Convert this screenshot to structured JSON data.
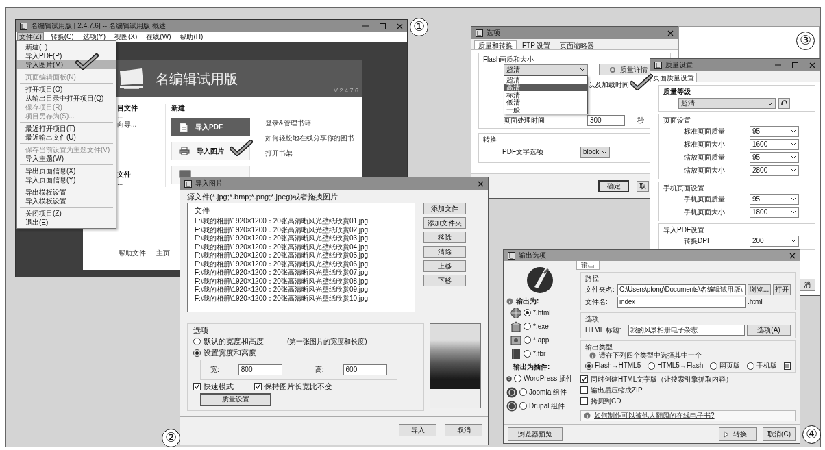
{
  "app_window": {
    "title": "名编辑试用版 [ 2.4.7.6] -- 名编辑试用版 概述",
    "menus": [
      {
        "label": "文件(Z)",
        "selected": true
      },
      {
        "label": "转换(C)",
        "selected": false
      },
      {
        "label": "选项(Y)",
        "selected": false
      },
      {
        "label": "视图(X)",
        "selected": false
      },
      {
        "label": "在线(W)",
        "selected": false
      },
      {
        "label": "帮助(H)",
        "selected": false
      }
    ],
    "file_menu": [
      {
        "items": [
          {
            "label": "新建(L)",
            "disabled": false,
            "selected": false
          },
          {
            "label": "导入PDF(P)",
            "disabled": false,
            "selected": false
          },
          {
            "label": "导入图片(M)",
            "disabled": false,
            "selected": true
          }
        ]
      },
      {
        "items": [
          {
            "label": "页面编辑面板(N)",
            "disabled": true,
            "selected": false
          }
        ]
      },
      {
        "items": [
          {
            "label": "打开项目(O)",
            "disabled": false,
            "selected": false
          },
          {
            "label": "从输出目录中打开项目(Q)",
            "disabled": false,
            "selected": false
          },
          {
            "label": "保存项目(R)",
            "disabled": true,
            "selected": false
          },
          {
            "label": "项目另存为(S)...",
            "disabled": true,
            "selected": false
          }
        ]
      },
      {
        "items": [
          {
            "label": "最近打开项目(T)",
            "disabled": false,
            "selected": false
          },
          {
            "label": "最近输出文件(U)",
            "disabled": false,
            "selected": false
          }
        ]
      },
      {
        "items": [
          {
            "label": "保存当前设置为主题文件(V)",
            "disabled": true,
            "selected": false
          },
          {
            "label": "导入主题(W)",
            "disabled": false,
            "selected": false
          }
        ]
      },
      {
        "items": [
          {
            "label": "导出页面信息(X)",
            "disabled": false,
            "selected": false
          },
          {
            "label": "导入页面信息(Y)",
            "disabled": false,
            "selected": false
          }
        ]
      },
      {
        "items": [
          {
            "label": "导出模板设置",
            "disabled": false,
            "selected": false
          },
          {
            "label": "导入模板设置",
            "disabled": false,
            "selected": false
          }
        ]
      },
      {
        "items": [
          {
            "label": "关闭项目(Z)",
            "disabled": false,
            "selected": false
          },
          {
            "label": "退出(E)",
            "disabled": false,
            "selected": false
          }
        ]
      }
    ],
    "banner": {
      "title": "名编辑试用版",
      "version": "V 2.4.7.6"
    },
    "recent_sections": [
      {
        "heading": "目文件",
        "lines": [
          "...",
          "向导..."
        ]
      },
      {
        "heading": "文件",
        "lines": [
          "..."
        ]
      }
    ],
    "new_section": {
      "heading": "新建",
      "tiles": [
        {
          "label": "导入PDF",
          "selected": true
        },
        {
          "label": "导入图片",
          "selected": false
        },
        {
          "selected": false
        }
      ]
    },
    "links": [
      "登录&管理书籍",
      "如何轻松地在线分享你的图书",
      "打开书架"
    ],
    "footer_links": [
      "帮助文件",
      "主页"
    ],
    "panel_number": "①"
  },
  "options_dialog": {
    "title": "选项",
    "tabs": [
      {
        "label": "质量和转换",
        "selected": true
      },
      {
        "label": "FTP 设置",
        "selected": false
      },
      {
        "label": "页面缩略器",
        "selected": false
      }
    ],
    "flash_group": "Flash画质和大小",
    "quality_value": "超清",
    "quality_options": [
      {
        "label": "超清",
        "selected": false
      },
      {
        "label": "高清",
        "selected": true
      },
      {
        "label": "标清",
        "selected": false
      },
      {
        "label": "低清",
        "selected": false
      },
      {
        "label": "一般",
        "selected": false
      }
    ],
    "details_button": "质量详情",
    "load_time_text": "以及加载时间",
    "time_label": "页面处理时间",
    "time_value": "300",
    "time_unit": "秒",
    "convert_group": "转换",
    "pdf_text_label": "PDF文字选项",
    "pdf_text_value": "block",
    "ok_button": "确定",
    "cancel_button": "取"
  },
  "import_dialog": {
    "title": "导入图片",
    "source_label": "源文件(*.jpg;*.bmp;*.png;*.jpeg)或者拖拽图片",
    "list_header": "文件",
    "files": [
      "F:\\我的相册\\1920×1200：20张高清晰风光壁纸欣赏01.jpg",
      "F:\\我的相册\\1920×1200：20张高清晰风光壁纸欣赏02.jpg",
      "F:\\我的相册\\1920×1200：20张高清晰风光壁纸欣赏03.jpg",
      "F:\\我的相册\\1920×1200：20张高清晰风光壁纸欣赏04.jpg",
      "F:\\我的相册\\1920×1200：20张高清晰风光壁纸欣赏05.jpg",
      "F:\\我的相册\\1920×1200：20张高清晰风光壁纸欣赏06.jpg",
      "F:\\我的相册\\1920×1200：20张高清晰风光壁纸欣赏07.jpg",
      "F:\\我的相册\\1920×1200：20张高清晰风光壁纸欣赏08.jpg",
      "F:\\我的相册\\1920×1200：20张高清晰风光壁纸欣赏09.jpg",
      "F:\\我的相册\\1920×1200：20张高清晰风光壁纸欣赏10.jpg"
    ],
    "side_buttons": [
      "添加文件",
      "添加文件夹",
      "移除",
      "清除",
      "上移",
      "下移"
    ],
    "options_label": "选项",
    "size_modes": [
      {
        "label": "默认的宽度和高度",
        "note": "(第一张图片的宽度和长度)",
        "selected": false
      },
      {
        "label": "设置宽度和高度",
        "selected": true
      }
    ],
    "width_label": "宽:",
    "width_value": "800",
    "height_label": "高:",
    "height_value": "600",
    "checkboxes": [
      {
        "label": "快速模式",
        "checked": true
      },
      {
        "label": "保持图片长宽比不变",
        "checked": true
      }
    ],
    "quality_button": "质量设置",
    "import_button": "导入",
    "cancel_button": "取消",
    "panel_number": "②"
  },
  "quality_dialog": {
    "title": "质量设置",
    "tab": "页面质量设置",
    "level_heading": "质量等级",
    "level_value": "超清",
    "sections": [
      {
        "title": "页面设置",
        "rows": [
          {
            "label": "标准页面质量",
            "value": "95"
          },
          {
            "label": "标准页面大小",
            "value": "1600"
          },
          {
            "label": "缩放页面质量",
            "value": "95"
          },
          {
            "label": "缩放页面大小",
            "value": "2800"
          }
        ]
      },
      {
        "title": "手机页面设置",
        "rows": [
          {
            "label": "手机页面质量",
            "value": "95"
          },
          {
            "label": "手机页面大小",
            "value": "1800"
          }
        ]
      },
      {
        "title": "导入PDF设置",
        "rows": [
          {
            "label": "转换DPI",
            "value": "200"
          }
        ]
      }
    ],
    "footer_button": "消",
    "panel_number": "③"
  },
  "output_dialog": {
    "title": "输出选项",
    "output_as": "输出为:",
    "formats": [
      {
        "label": "*.html",
        "selected": true
      },
      {
        "label": "*.exe",
        "selected": false
      },
      {
        "label": "*.app",
        "selected": false
      },
      {
        "label": "*.fbr",
        "selected": false
      }
    ],
    "plugins_heading": "输出为插件:",
    "plugins": [
      {
        "label": "WordPress 插件",
        "selected": false
      },
      {
        "label": "Joomla 组件",
        "selected": false
      },
      {
        "label": "Drupal 组件",
        "selected": false
      }
    ],
    "preview_button": "浏览器预览",
    "tab": "输出",
    "path_group": "路径",
    "folder_label": "文件夹名:",
    "folder_value": "C:\\Users\\pfong\\Documents\\名编辑试用版\\",
    "browse_button": "浏览...",
    "open_button": "打开",
    "file_label": "文件名:",
    "file_value": "index",
    "file_ext": ".html",
    "options_group": "选项",
    "html_title_label": "HTML 标题:",
    "html_title_value": "我的风景相册电子杂志",
    "options_button": "选项(A)",
    "type_group": "输出类型",
    "type_hint": "请在下列四个类型中选择其中一个",
    "types": [
      {
        "label": "Flash→HTML5",
        "selected": true
      },
      {
        "label": "HTML5→Flash",
        "selected": false
      },
      {
        "label": "网页版",
        "selected": false
      },
      {
        "label": "手机版",
        "selected": false
      }
    ],
    "checkboxes": [
      {
        "label": "同时创建HTML文字版（让搜索引擎抓取内容）",
        "checked": true
      },
      {
        "label": "输出后压缩成ZIP",
        "checked": false
      },
      {
        "label": "拷贝到CD",
        "checked": false
      }
    ],
    "help_link": "如何制作可以被他人翻阅的在线电子书?",
    "convert_button": "转换",
    "cancel_button": "取消(C)",
    "panel_number": "④"
  }
}
